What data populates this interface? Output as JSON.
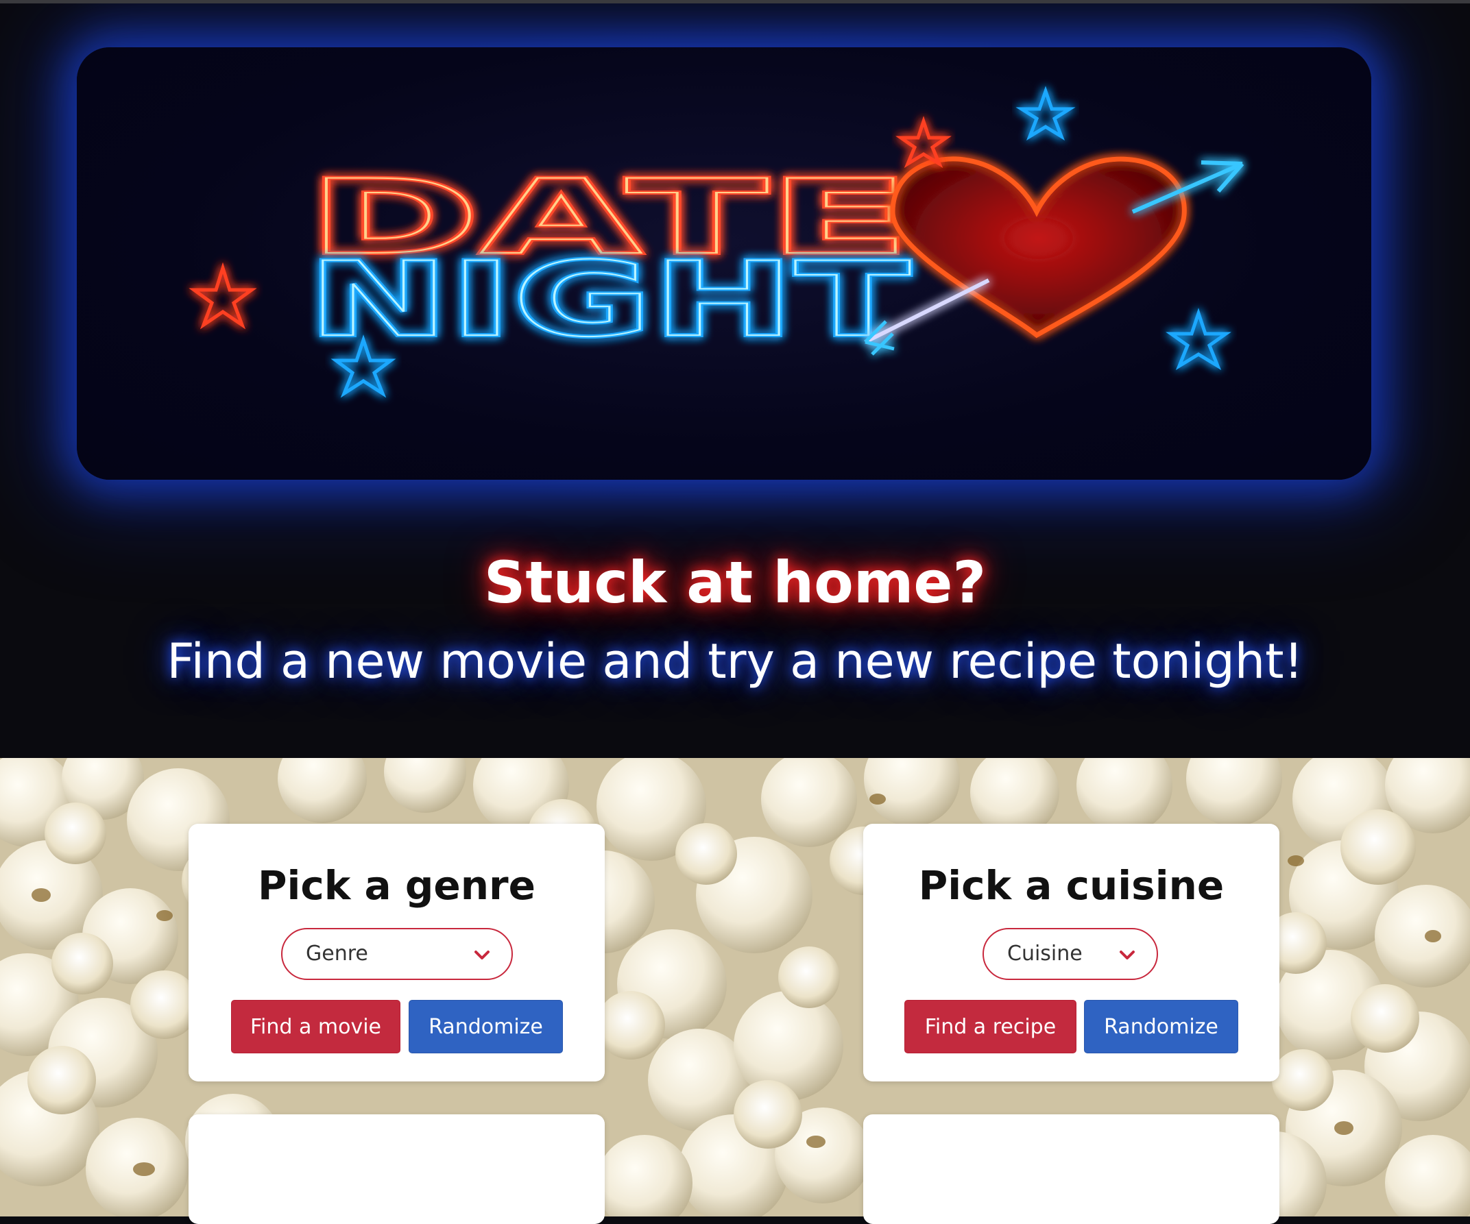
{
  "hero": {
    "banner_text_line1": "DATE",
    "banner_text_line2": "NIGHT",
    "headline": "Stuck at home?",
    "subline": "Find a new movie and try a new recipe tonight!"
  },
  "movie_card": {
    "title": "Pick a genre",
    "select_value": "Genre",
    "find_button": "Find a movie",
    "randomize_button": "Randomize"
  },
  "recipe_card": {
    "title": "Pick a cuisine",
    "select_value": "Cuisine",
    "find_button": "Find a recipe",
    "randomize_button": "Randomize"
  },
  "colors": {
    "primary_red": "#c32a3e",
    "primary_blue": "#2f63c2",
    "neon_red": "#ff3a2a",
    "neon_blue": "#3fd2ff"
  },
  "icons": [
    "chevron-down-icon",
    "star-icon",
    "heart-icon",
    "arrow-icon"
  ]
}
